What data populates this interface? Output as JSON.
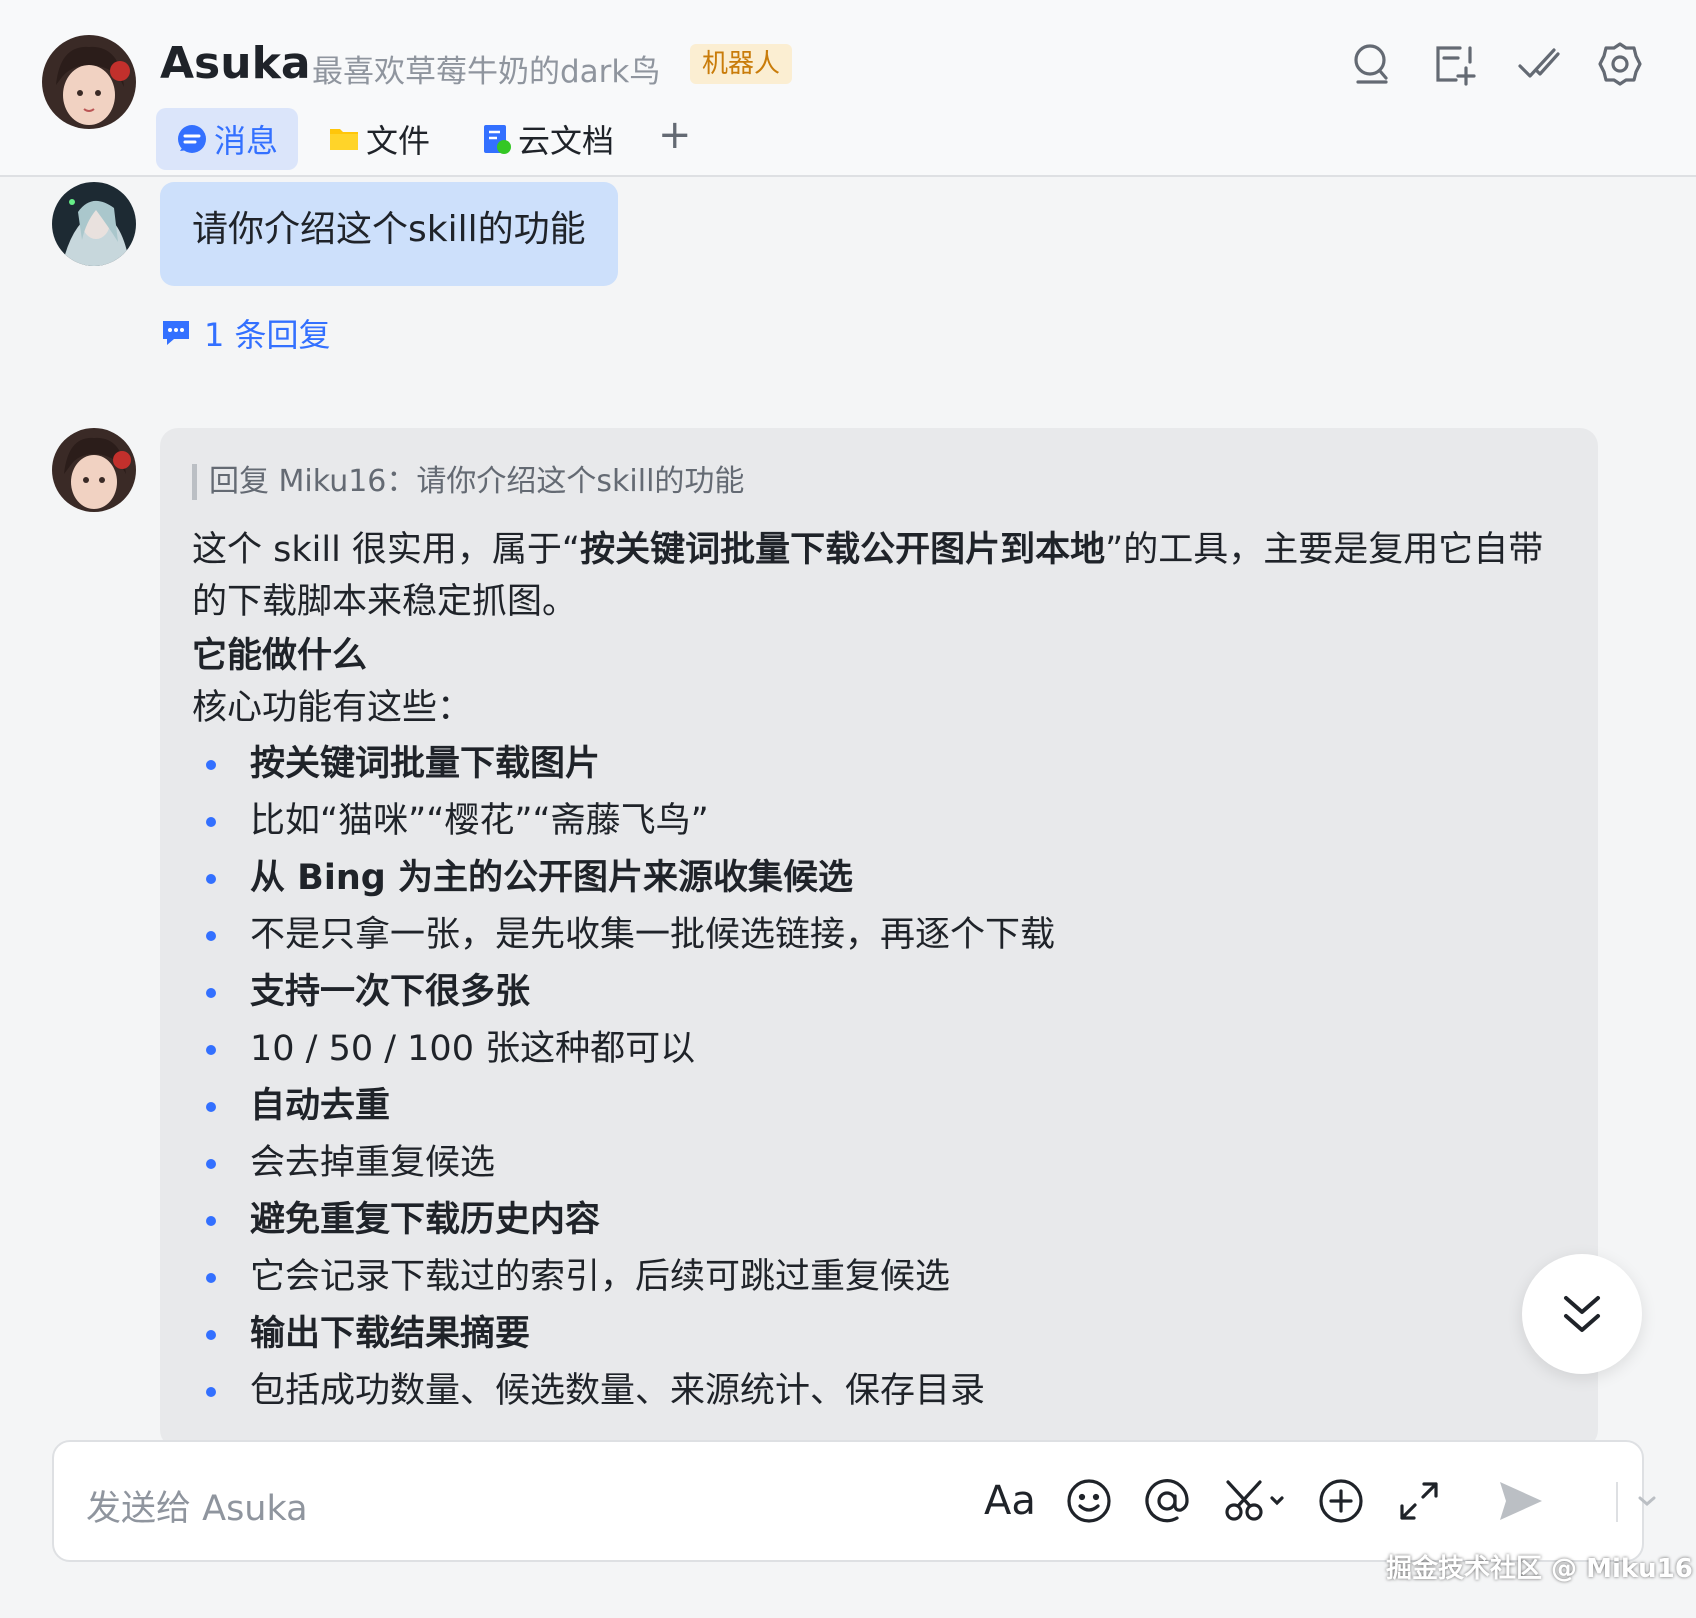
{
  "header": {
    "name": "Asuka",
    "signature": "最喜欢草莓牛奶的dark鸟",
    "badge": "机器人",
    "icons": [
      "search-icon",
      "add-screen-icon",
      "check-list-icon",
      "settings-icon"
    ],
    "tabs": [
      {
        "label": "消息",
        "icon": "message-icon",
        "active": true
      },
      {
        "label": "文件",
        "icon": "folder-icon",
        "active": false
      },
      {
        "label": "云文档",
        "icon": "doc-icon",
        "active": false
      }
    ],
    "add_tab": "+"
  },
  "messages": {
    "user": {
      "text": "请你介绍这个skill的功能",
      "reply_count": "1 条回复"
    },
    "bot": {
      "quote": "回复 Miku16：请你介绍这个skill的功能",
      "intro_1": "这个 skill 很实用，属于“",
      "intro_bold": "按关键词批量下载公开图片到本地",
      "intro_2": "”的工具，主要是复用它自带的下载脚本来稳定抓图。",
      "heading": "它能做什么",
      "lead": "核心功能有这些：",
      "items": [
        {
          "text": "按关键词批量下载图片",
          "bold": true
        },
        {
          "text": "比如“猫咪”“樱花”“斋藤飞鸟”",
          "bold": false
        },
        {
          "text": "从 Bing 为主的公开图片来源收集候选",
          "bold": true
        },
        {
          "text": "不是只拿一张，是先收集一批候选链接，再逐个下载",
          "bold": false
        },
        {
          "text": "支持一次下很多张",
          "bold": true
        },
        {
          "text": "10 / 50 / 100 张这种都可以",
          "bold": false
        },
        {
          "text": "自动去重",
          "bold": true
        },
        {
          "text": "会去掉重复候选",
          "bold": false
        },
        {
          "text": "避免重复下载历史内容",
          "bold": true
        },
        {
          "text": "它会记录下载过的索引，后续可跳过重复候选",
          "bold": false
        },
        {
          "text": "输出下载结果摘要",
          "bold": true
        },
        {
          "text": "包括成功数量、候选数量、来源统计、保存目录",
          "bold": false
        }
      ]
    }
  },
  "input": {
    "placeholder": "发送给 Asuka",
    "font_tool": "Aa",
    "tools": [
      "font-icon",
      "emoji-icon",
      "mention-icon",
      "screenshot-icon",
      "plus-circle-icon",
      "expand-icon",
      "send-icon",
      "chevron-down-icon"
    ]
  },
  "watermark": "掘金技术社区 @ Miku16",
  "colors": {
    "accent": "#3370ff",
    "user_bubble": "#cde0fb",
    "bot_bubble": "#e8e9eb",
    "badge_bg": "#fbeed2",
    "badge_text": "#c97c0a"
  }
}
